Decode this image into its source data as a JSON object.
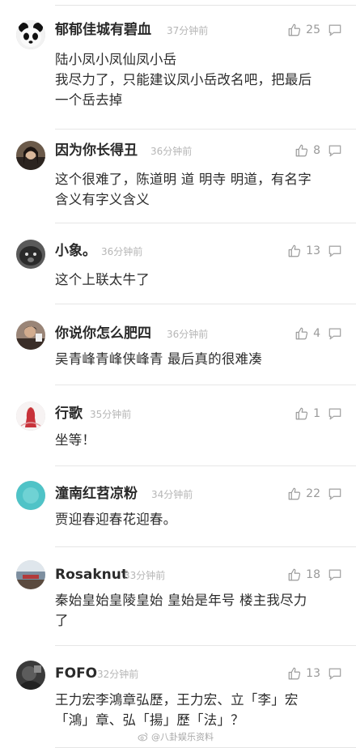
{
  "comments": [
    {
      "username": "郁郁佳城有碧血",
      "time": "37分钟前",
      "likes": "25",
      "body": "陆小凤小凤仙凤小岳\n我尽力了，只能建议凤小岳改名吧，把最后\n一个岳去掉",
      "avatar": "panda-avatar"
    },
    {
      "username": "因为你长得丑",
      "time": "36分钟前",
      "likes": "8",
      "body": "这个很难了，陈道明 道 明寺 明道，有名字\n含义有字义含义",
      "avatar": "portrait-avatar"
    },
    {
      "username": "小象。",
      "time": "36分钟前",
      "likes": "13",
      "body": "这个上联太牛了",
      "avatar": "dark-animal-avatar"
    },
    {
      "username": "你说你怎么肥四",
      "time": "36分钟前",
      "likes": "4",
      "body": "吴青峰青峰侠峰青 最后真的很难凑",
      "avatar": "person-avatar"
    },
    {
      "username": "行歌",
      "time": "35分钟前",
      "likes": "1",
      "body": "坐等！",
      "avatar": "red-figure-avatar"
    },
    {
      "username": "潼南红苕凉粉",
      "time": "34分钟前",
      "likes": "22",
      "body": "贾迎春迎春花迎春。",
      "avatar": "teal-avatar"
    },
    {
      "username": "Rosaknut",
      "time": "33分钟前",
      "likes": "18",
      "body": "秦始皇始皇陵皇始 皇始是年号 楼主我尽力\n了",
      "avatar": "landscape-avatar"
    },
    {
      "username": "FOFO",
      "time": "32分钟前",
      "likes": "13",
      "body": "王力宏李鴻章弘歷，王力宏、立「李」宏\n「鴻」章、弘「揚」歷「法」？",
      "avatar": "dark-photo-avatar"
    }
  ],
  "watermark": "@八卦娱乐资料"
}
